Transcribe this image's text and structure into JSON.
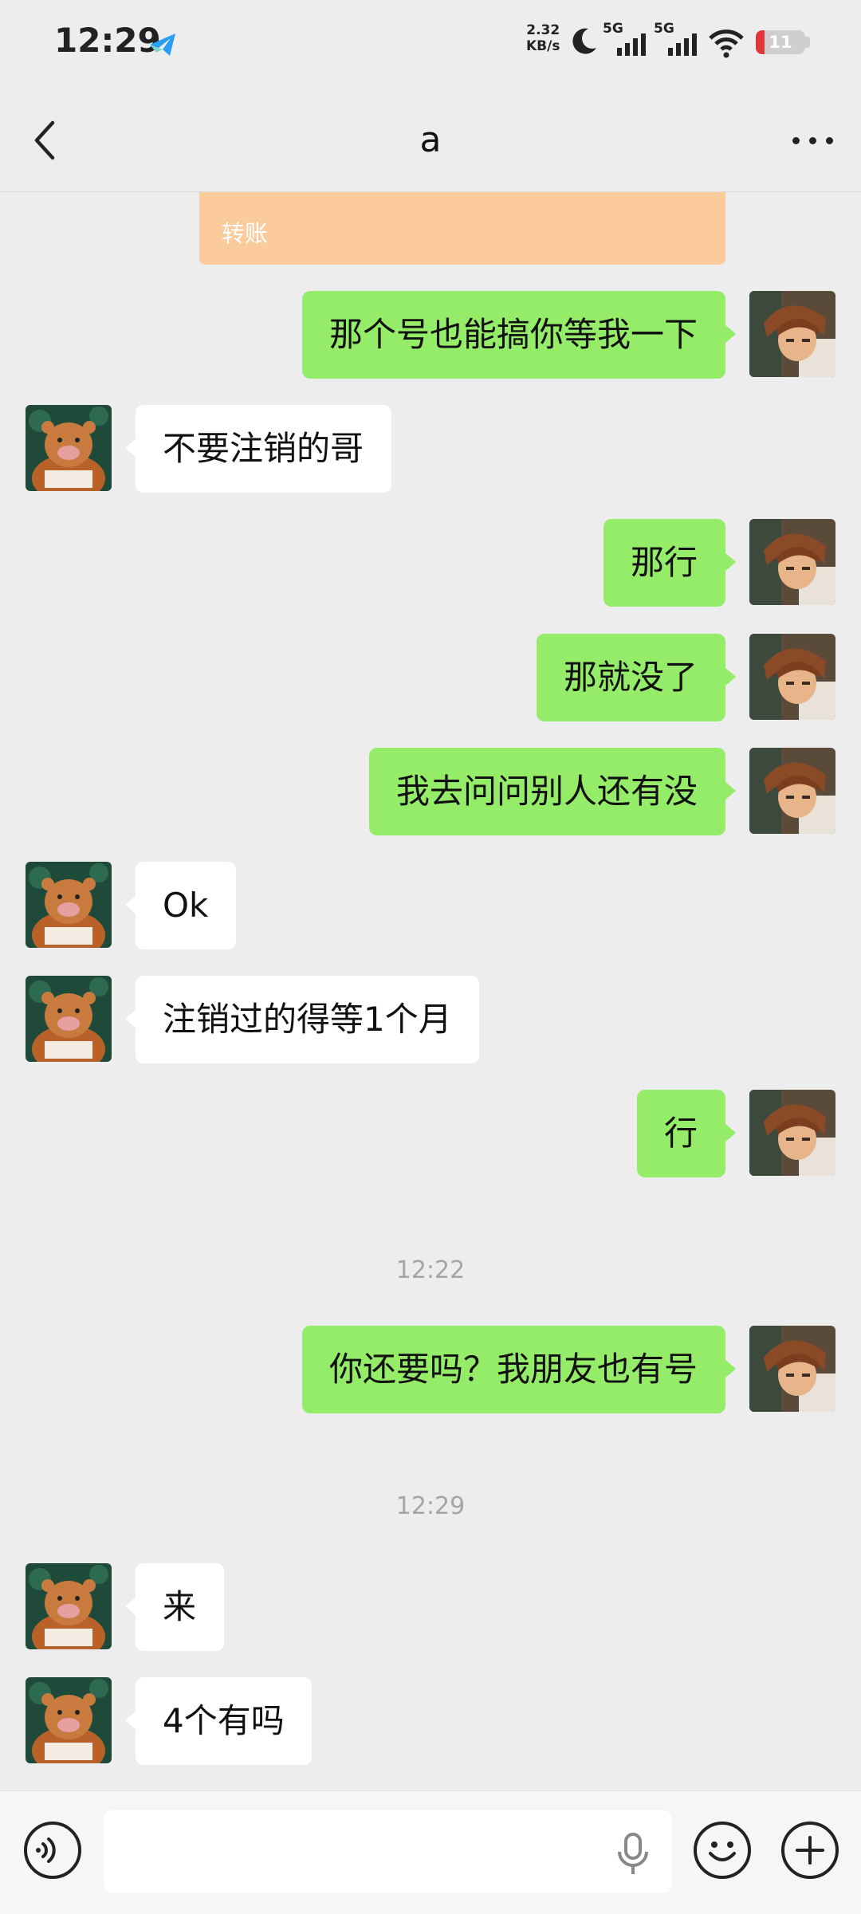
{
  "status_bar": {
    "time": "12:29",
    "net_speed_value": "2.32",
    "net_speed_unit": "KB/s",
    "sim1_label": "5G",
    "sim2_label": "5G",
    "battery_level": "11",
    "battery_color": "#e0363a"
  },
  "nav": {
    "title": "a"
  },
  "transfer": {
    "label": "转账",
    "color": "#fccb9c"
  },
  "messages": [
    {
      "sender": "self",
      "text": "那个号也能搞你等我一下"
    },
    {
      "sender": "other",
      "text": "不要注销的哥"
    },
    {
      "sender": "self",
      "text": "那行"
    },
    {
      "sender": "self",
      "text": "那就没了"
    },
    {
      "sender": "self",
      "text": "我去问问别人还有没"
    },
    {
      "sender": "other",
      "text": "Ok"
    },
    {
      "sender": "other",
      "text": "注销过的得等1个月"
    },
    {
      "sender": "self",
      "text": "行"
    },
    {
      "timestamp": "12:22"
    },
    {
      "sender": "self",
      "text": "你还要吗？我朋友也有号"
    },
    {
      "timestamp": "12:29"
    },
    {
      "sender": "other",
      "text": "来"
    },
    {
      "sender": "other",
      "text": "4个有吗"
    }
  ],
  "input_bar": {
    "value": "",
    "icons": [
      "voice-icon",
      "mic-icon",
      "emoji-icon",
      "plus-icon"
    ]
  },
  "colors": {
    "self_bubble": "#95ec69",
    "other_bubble": "#ffffff",
    "background": "#ededed"
  }
}
